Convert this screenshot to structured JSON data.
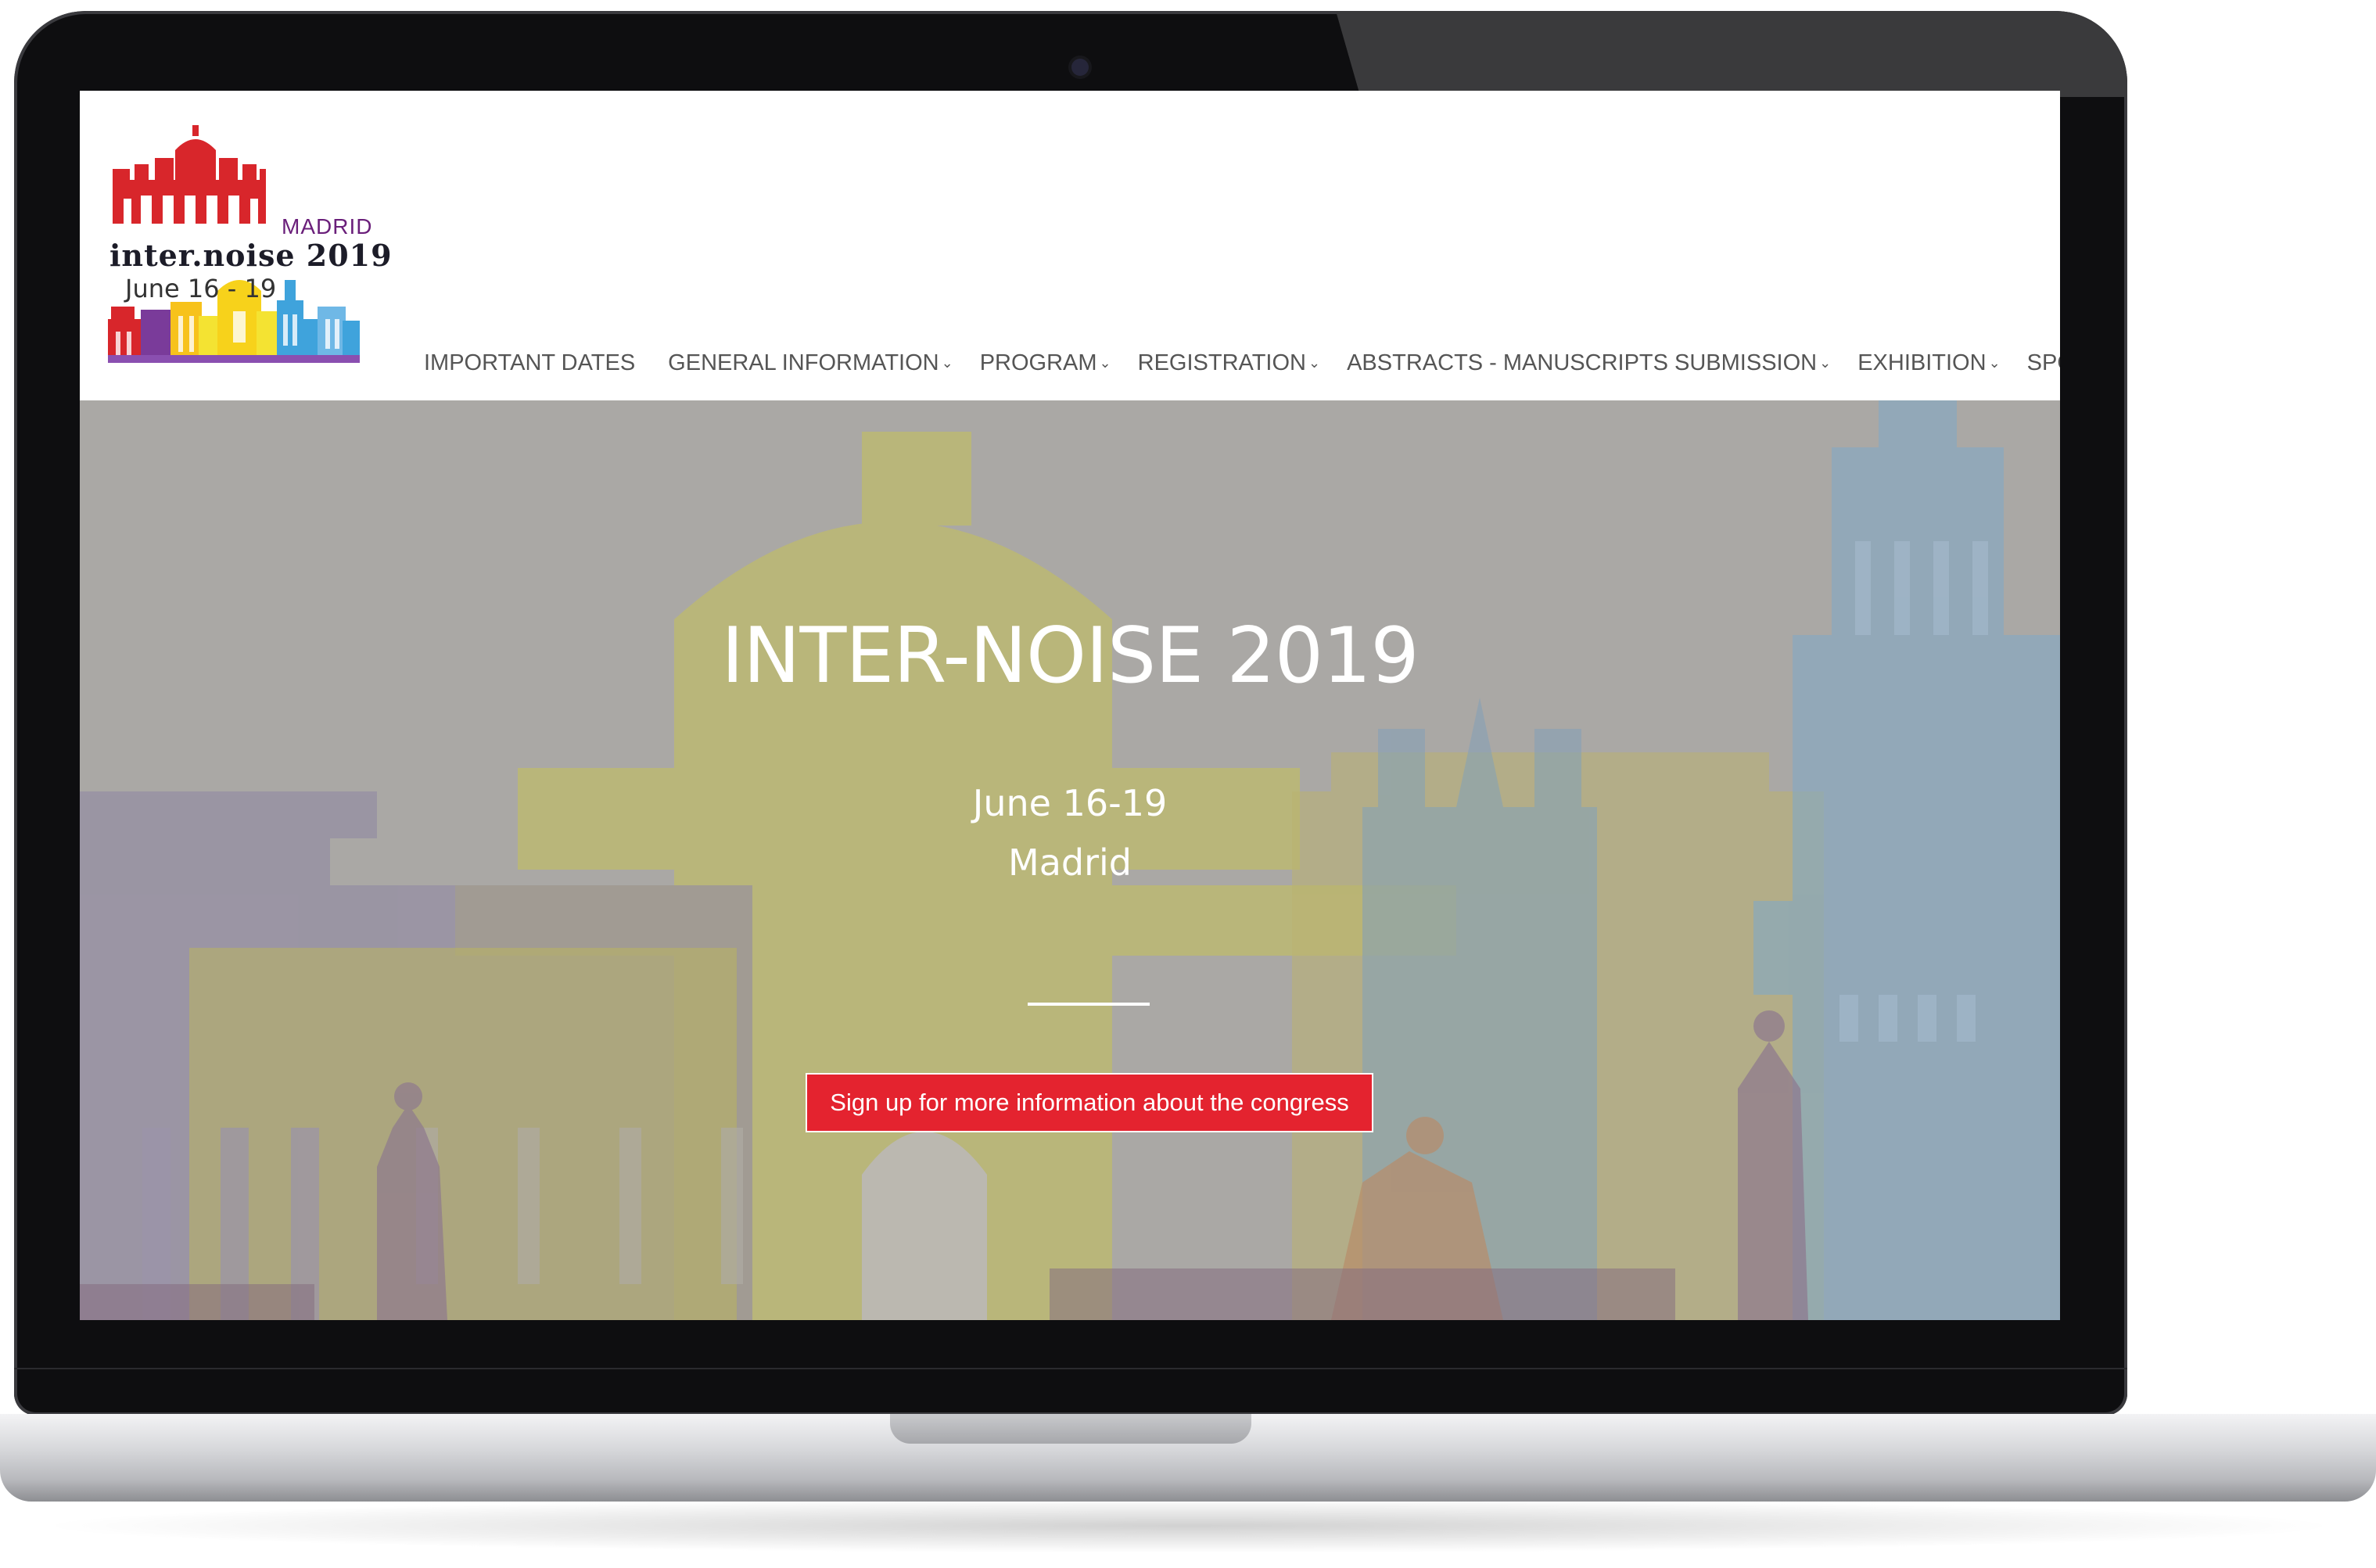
{
  "logo": {
    "city": "MADRID",
    "brand": "inter.noise 2019",
    "dates": "June 16 - 19",
    "icon": "madrid-skyline-logo"
  },
  "nav": {
    "items": [
      {
        "label": "IMPORTANT DATES",
        "dropdown": false
      },
      {
        "label": "GENERAL INFORMATION",
        "dropdown": true
      },
      {
        "label": "PROGRAM",
        "dropdown": true
      },
      {
        "label": "REGISTRATION",
        "dropdown": true
      },
      {
        "label": "ABSTRACTS - MANUSCRIPTS SUBMISSION",
        "dropdown": true
      },
      {
        "label": "EXHIBITION",
        "dropdown": true
      },
      {
        "label": "SPONSORS",
        "dropdown": false
      }
    ],
    "caret_icon": "chevron-down-icon"
  },
  "hero": {
    "title": "INTER-NOISE 2019",
    "date": "June 16-19",
    "city": "Madrid",
    "cta_label": "Sign up for more information about the congress",
    "background": "madrid-landmarks-illustration"
  },
  "colors": {
    "accent": "#e4232f",
    "hero_bg": "#b2b0ac",
    "nav_text": "#555555",
    "logo_red": "#d8262b"
  }
}
